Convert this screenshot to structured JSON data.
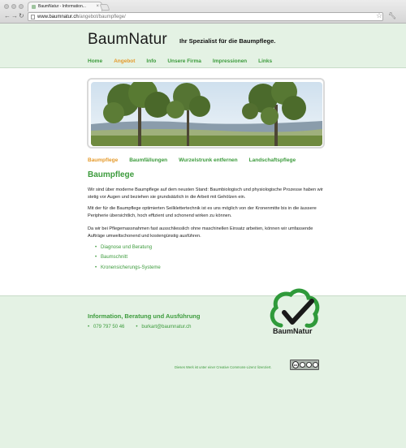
{
  "browser": {
    "tab_title": "BaumNatur - Information...",
    "url_host": "www.baumnatur.ch",
    "url_path": "/angebot/baumpflege/"
  },
  "header": {
    "logo": "BaumNatur",
    "tagline": "Ihr Spezialist für die Baumpflege."
  },
  "main_nav": {
    "active": "Angebot",
    "items": [
      "Home",
      "Angebot",
      "Info",
      "Unsere Firma",
      "Impressionen",
      "Links"
    ]
  },
  "sub_nav": {
    "active": "Baumpflege",
    "items": [
      "Baumpflege",
      "Baumfällungen",
      "Wurzelstrunk entfernen",
      "Landschaftspflege"
    ]
  },
  "content": {
    "heading": "Baumpflege",
    "paragraphs": [
      "Wir sind über moderne Baumpflege auf dem neusten Stand: Baumbiologisch und physiologische Prozesse haben wir stetig vor Augen und beziehen sie grundsätzlich in die Arbeit mit Gehölzen ein.",
      "Mit der für die Baumpflege optimierten Seilklettertechnik ist es uns möglich von der Kronenmitte  bis in die äussere Peripherie übersichtlich, hoch effizient und schonend wirken zu können.",
      "Da wir bei Pflegemassnahmen fast ausschliesslich ohne maschinellen Einsatz arbeiten, können wir umfassende Aufträge umweltschonend und kostengünstig ausführen."
    ],
    "links": [
      "Diagnose und Beratung",
      "Baumschnitt",
      "Kronensicherungs-Systeme"
    ]
  },
  "footer": {
    "title": "Information, Beratung und Ausführung",
    "phone": "079 797 50 46",
    "email": "burkart@baumnatur.ch",
    "logo_text": "BaumNatur",
    "license_text": "Dieses Werk ist unter einer Creative Commons-Lizenz lizenziert.",
    "cc_label": "cc"
  },
  "colors": {
    "green": "#3c9b3c",
    "orange": "#e59a2b",
    "background": "#e4f2e4"
  }
}
